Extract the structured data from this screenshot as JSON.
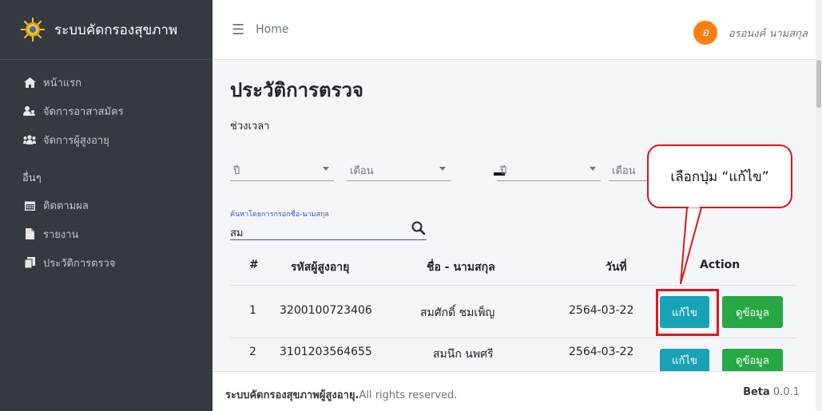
{
  "brand": {
    "title": "ระบบคัดกรองสุขภาพ"
  },
  "sidebar": {
    "items": [
      {
        "label": "หน้าแรก",
        "icon": "home-icon"
      },
      {
        "label": "จัดการอาสาสมัคร",
        "icon": "users-icon"
      },
      {
        "label": "จัดการผู้สูงอายุ",
        "icon": "group-icon"
      }
    ],
    "section_header": "อื่นๆ",
    "other_items": [
      {
        "label": "ติดตามผล",
        "icon": "calendar-icon"
      },
      {
        "label": "รายงาน",
        "icon": "file-icon"
      },
      {
        "label": "ประวัติการตรวจ",
        "icon": "copy-icon"
      }
    ]
  },
  "topbar": {
    "home": "Home",
    "user_initial": "อ",
    "user_name": "อรอนงค์ นามสกุล"
  },
  "page": {
    "title": "ประวัติการตรวจ",
    "period_label": "ช่วงเวลา"
  },
  "filters": {
    "from_year": "ปี",
    "from_month": "เดือน",
    "to_year": "ปี",
    "to_month": "เดือน"
  },
  "search": {
    "caption": "ค้นหาโดยการกรอกชื่อ-นามสกุล",
    "value": "สม"
  },
  "table": {
    "headers": [
      "#",
      "รหัสผู้สูงอายุ",
      "ชื่อ - นามสกุล",
      "วันที่",
      "Action"
    ],
    "rows": [
      {
        "no": "1",
        "id": "3200100723406",
        "name": "สมศักดิ์ ชมเพ็ญ",
        "date": "2564-03-22",
        "edit": "แก้ไข",
        "view": "ดูข้อมูล"
      },
      {
        "no": "2",
        "id": "3101203564655",
        "name": "สมนึก นพศรี",
        "date": "2564-03-22",
        "edit": "แก้ไข",
        "view": "ดูข้อมูล"
      }
    ]
  },
  "callout": {
    "text": "เลือกปุ่ม “แก้ไข”"
  },
  "footer": {
    "brand": "ระบบคัดกรองสุขภาพผู้สูงอายุ.",
    "rights": "All rights reserved.",
    "version_label": "Beta",
    "version": "0.0.1"
  },
  "colors": {
    "sidebar": "#343a40",
    "edit_button": "#17a2b8",
    "view_button": "#28a745",
    "annotation": "#e0151b",
    "avatar": "#fd7e14"
  }
}
